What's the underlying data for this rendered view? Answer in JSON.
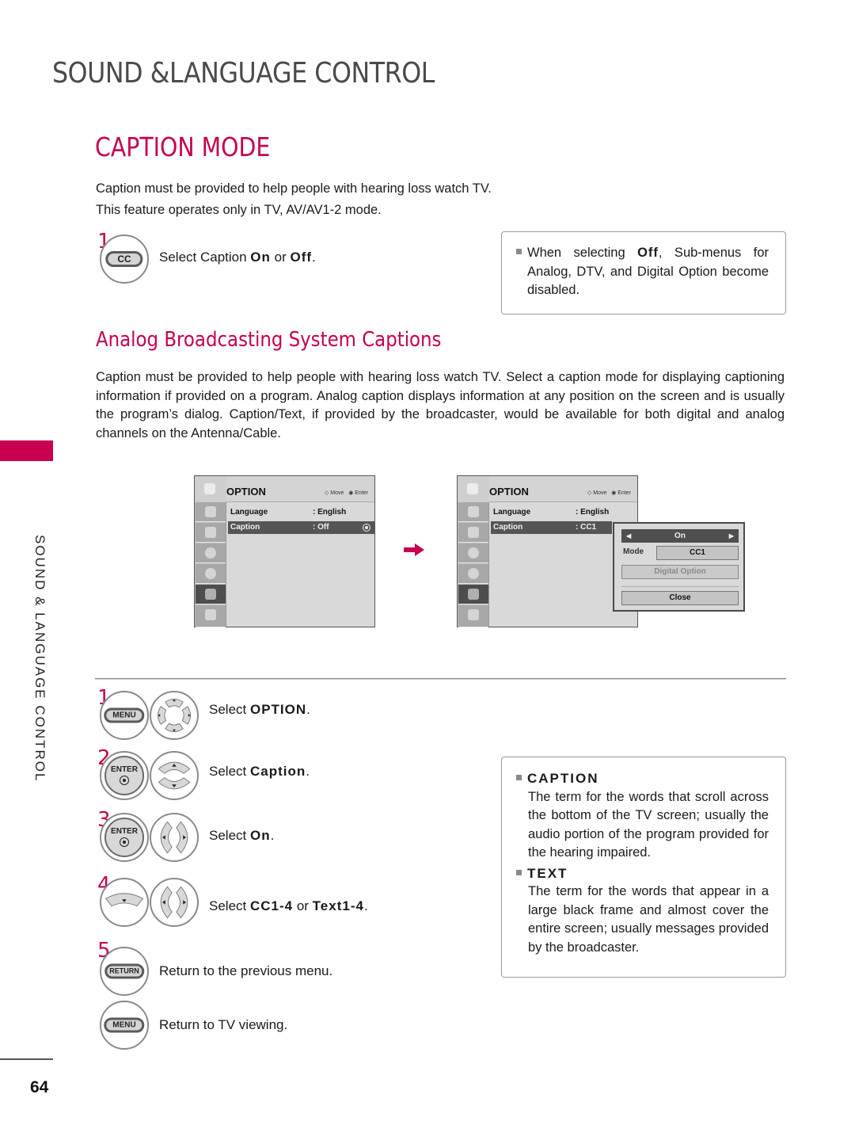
{
  "chapter_title": "SOUND &LANGUAGE CONTROL",
  "section_title": "CAPTION MODE",
  "intro": [
    "Caption must be provided to help people with hearing loss watch TV.",
    "This feature operates only in TV, AV/AV1-2 mode."
  ],
  "top_step": {
    "number": "1",
    "button": "CC",
    "text_prefix": "Select Caption ",
    "bold1": "On",
    "text_mid": " or ",
    "bold2": "Off",
    "text_suffix": "."
  },
  "note_off": {
    "prefix": "When selecting ",
    "bold": "Off",
    "suffix": ", Sub-menus for Analog, DTV, and Digital Option become disabled."
  },
  "analog": {
    "title": "Analog Broadcasting System Captions",
    "paragraph": "Caption must be provided to help people with hearing loss watch TV. Select a caption mode for displaying captioning information if provided on a program. Analog caption displays information at any position on the screen and is usually the program’s dialog. Caption/Text, if provided by the broadcaster, would be available for both digital and analog channels on the Antenna/Cable."
  },
  "side_label": "SOUND & LANGUAGE CONTROL",
  "page_number": "64",
  "accent_color": "#c8004f",
  "screen1": {
    "title": "OPTION",
    "hint_move": "Move",
    "hint_enter": "Enter",
    "rows": [
      {
        "label": "Language",
        "value": ": English",
        "selected": false
      },
      {
        "label": "Caption",
        "value": ": Off",
        "selected": true
      }
    ],
    "rail_icons": [
      "picture-icon",
      "screen-icon",
      "audio-icon",
      "time-icon",
      "option-icon",
      "lock-icon"
    ],
    "active_rail": 4
  },
  "screen2": {
    "title": "OPTION",
    "hint_move": "Move",
    "hint_enter": "Enter",
    "rows": [
      {
        "label": "Language",
        "value": ": English",
        "selected": false
      },
      {
        "label": "Caption",
        "value": ": CC1",
        "selected": true
      }
    ],
    "popup": {
      "toggle_value": "On",
      "left_arrow": "◀",
      "right_arrow": "▶",
      "mode_label": "Mode",
      "mode_value": "CC1",
      "digital_option": "Digital Option",
      "close": "Close"
    }
  },
  "steps": [
    {
      "number": "1",
      "buttons": [
        "MENU",
        "dpad"
      ],
      "text": "Select ",
      "bold": "OPTION",
      "suffix": "."
    },
    {
      "number": "2",
      "buttons": [
        "ENTER",
        "updown"
      ],
      "text": "Select ",
      "bold": "Caption",
      "suffix": "."
    },
    {
      "number": "3",
      "buttons": [
        "ENTER",
        "leftright"
      ],
      "text": "Select ",
      "bold": "On",
      "suffix": "."
    },
    {
      "number": "4",
      "buttons": [
        "down",
        "leftright"
      ],
      "text": "Select ",
      "bold": "CC1-4",
      "mid": " or ",
      "bold2": "Text1-4",
      "suffix": "."
    },
    {
      "number": "5",
      "buttons": [
        "RETURN"
      ],
      "text": "Return to the previous menu."
    },
    {
      "number": "",
      "buttons": [
        "MENU"
      ],
      "text": "Return to TV viewing."
    }
  ],
  "enter_label": "ENTER",
  "definitions": [
    {
      "term": "CAPTION",
      "text": "The term for the words that scroll across the bottom of the TV screen; usually the audio portion of the program provided for the hearing impaired."
    },
    {
      "term": "TEXT",
      "text": "The term for the words that appear in a large black frame and almost cover the entire screen; usually messages provided by the broadcaster."
    }
  ]
}
